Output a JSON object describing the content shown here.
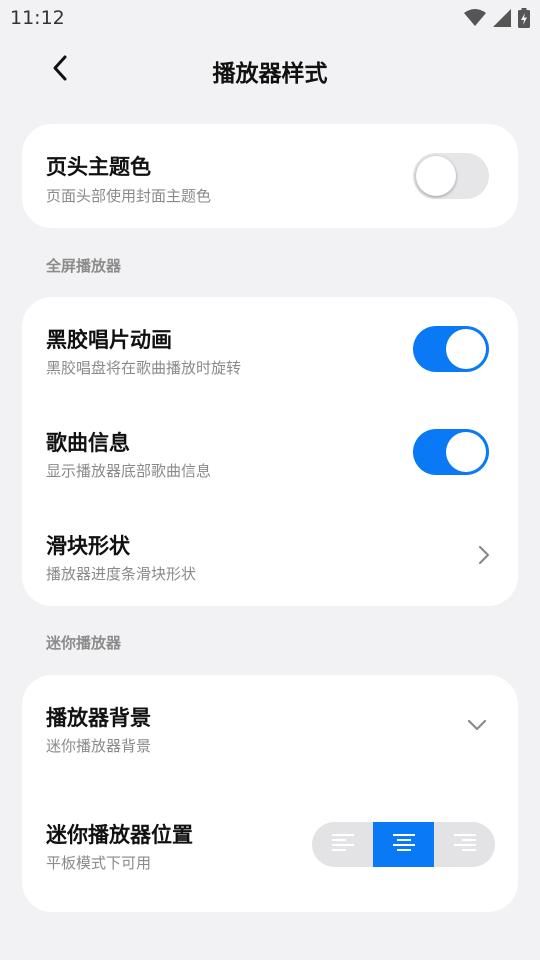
{
  "status_bar": {
    "time": "11:12",
    "icons": [
      "wifi-icon",
      "signal-icon",
      "battery-charging-icon"
    ]
  },
  "header": {
    "title": "播放器样式",
    "back_icon": "chevron-left-icon"
  },
  "header_card": {
    "title": "页头主题色",
    "subtitle": "页面头部使用封面主题色",
    "toggle_on": false
  },
  "fullscreen_section": {
    "label": "全屏播放器",
    "items": [
      {
        "title": "黑胶唱片动画",
        "subtitle": "黑胶唱盘将在歌曲播放时旋转",
        "control": "toggle",
        "toggle_on": true
      },
      {
        "title": "歌曲信息",
        "subtitle": "显示播放器底部歌曲信息",
        "control": "toggle",
        "toggle_on": true
      },
      {
        "title": "滑块形状",
        "subtitle": "播放器进度条滑块形状",
        "control": "chevron-right-icon"
      }
    ]
  },
  "mini_section": {
    "label": "迷你播放器",
    "items": [
      {
        "title": "播放器背景",
        "subtitle": "迷你播放器背景",
        "control": "chevron-down-icon"
      },
      {
        "title": "迷你播放器位置",
        "subtitle": "平板模式下可用",
        "control": "segmented",
        "options": [
          "align-left-icon",
          "align-center-icon",
          "align-right-icon"
        ],
        "selected_index": 1
      }
    ]
  },
  "colors": {
    "accent": "#0a79f5",
    "background": "#f2f2f4",
    "card": "#ffffff",
    "toggle_off": "#e6e6e9",
    "subtitle": "#8a8a8a",
    "section_label": "#8c8c8c"
  }
}
